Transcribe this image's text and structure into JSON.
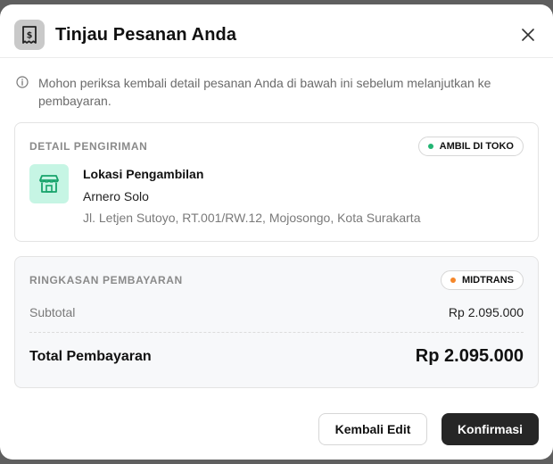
{
  "modal": {
    "title": "Tinjau Pesanan Anda",
    "header_icon": "receipt-icon",
    "close_icon": "close-icon",
    "info_icon": "info-icon",
    "info_text": "Mohon periksa kembali detail pesanan Anda di bawah ini sebelum melanjutkan ke pembayaran."
  },
  "shipping": {
    "section_title": "DETAIL PENGIRIMAN",
    "badge": "AMBIL DI TOKO",
    "badge_color": "#22b573",
    "icon": "store-icon",
    "location_label": "Lokasi Pengambilan",
    "store_name": "Arnero Solo",
    "address": "Jl. Letjen Sutoyo, RT.001/RW.12, Mojosongo, Kota Surakarta"
  },
  "payment": {
    "section_title": "RINGKASAN PEMBAYARAN",
    "badge": "MIDTRANS",
    "badge_color": "#f5872a",
    "subtotal_label": "Subtotal",
    "subtotal_value": "Rp 2.095.000",
    "total_label": "Total Pembayaran",
    "total_value": "Rp 2.095.000"
  },
  "actions": {
    "back_label": "Kembali Edit",
    "confirm_label": "Konfirmasi"
  }
}
